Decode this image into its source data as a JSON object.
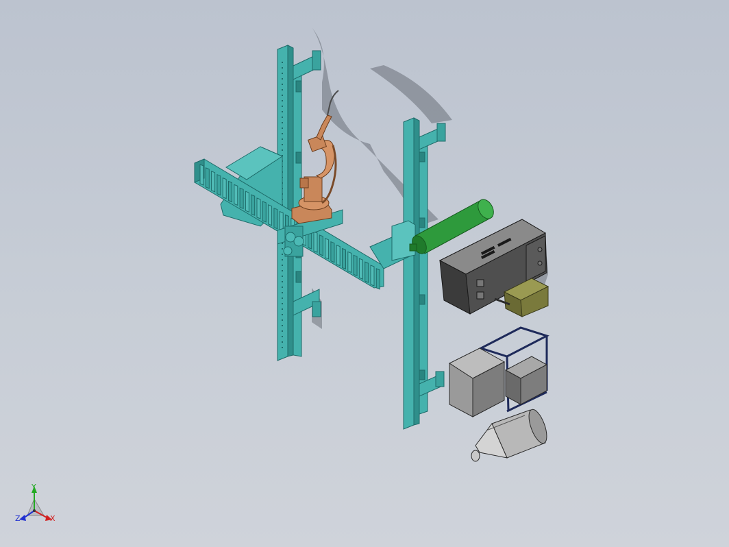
{
  "viewport": {
    "background_top": "#bcc3cf",
    "background_bottom": "#cfd3da"
  },
  "colors": {
    "frame": "#45b2ad",
    "frame_dark": "#1e6b69",
    "robot": "#c9875a",
    "cylinder": "#2e9a3c",
    "cabinet": "#4a4a4a",
    "box_grey": "#8f8f8f",
    "olive": "#7a7a3c",
    "hopper": "#b8b8b8"
  },
  "triad": {
    "x_label": "X",
    "y_label": "Y",
    "z_label": "Z",
    "x_color": "#d22020",
    "y_color": "#22aa22",
    "z_color": "#2030d0"
  },
  "model": {
    "components": [
      "left-column",
      "right-column",
      "horizontal-boom",
      "welding-robot",
      "gas-cylinder",
      "control-cabinet",
      "wire-feeder",
      "power-box",
      "hopper"
    ]
  }
}
